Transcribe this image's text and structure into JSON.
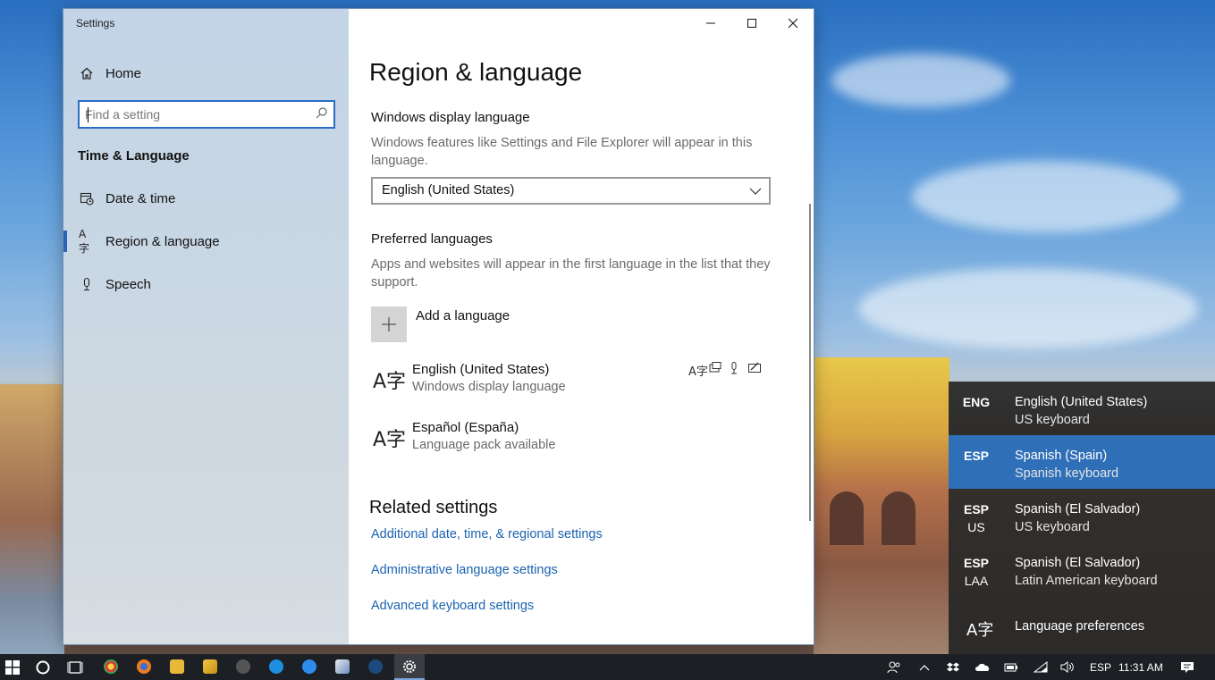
{
  "window": {
    "title": "Settings",
    "minimize_glyph": "—",
    "maximize_glyph": "☐",
    "close_glyph": "✕"
  },
  "sidebar": {
    "home_label": "Home",
    "search_placeholder": "Find a setting",
    "group_title": "Time & Language",
    "items": [
      {
        "label": "Date & time",
        "icon": "calendar-clock-icon"
      },
      {
        "label": "Region & language",
        "icon": "language-icon",
        "active": true
      },
      {
        "label": "Speech",
        "icon": "microphone-icon"
      }
    ]
  },
  "main": {
    "title": "Region & language",
    "display_language": {
      "heading": "Windows display language",
      "description": "Windows features like Settings and File Explorer will appear in this language.",
      "selected": "English (United States)"
    },
    "preferred": {
      "heading": "Preferred languages",
      "description": "Apps and websites will appear in the first language in the list that they support.",
      "add_label": "Add a language",
      "languages": [
        {
          "name": "English (United States)",
          "status": "Windows display language"
        },
        {
          "name": "Español (España)",
          "status": "Language pack available"
        }
      ]
    },
    "related": {
      "heading": "Related settings",
      "links": [
        "Additional date, time, & regional settings",
        "Administrative language settings",
        "Advanced keyboard settings"
      ]
    }
  },
  "flyout": {
    "items": [
      {
        "code": "ENG",
        "sub": "",
        "name": "English (United States)",
        "keyboard": "US keyboard",
        "selected": false
      },
      {
        "code": "ESP",
        "sub": "",
        "name": "Spanish (Spain)",
        "keyboard": "Spanish keyboard",
        "selected": true
      },
      {
        "code": "ESP",
        "sub": "US",
        "name": "Spanish (El Salvador)",
        "keyboard": "US keyboard",
        "selected": false
      },
      {
        "code": "ESP",
        "sub": "LAA",
        "name": "Spanish (El Salvador)",
        "keyboard": "Latin American keyboard",
        "selected": false
      }
    ],
    "preferences_label": "Language preferences"
  },
  "taskbar": {
    "input_indicator": "ESP",
    "clock": "11:31 AM"
  },
  "colors": {
    "accent": "#2f6fb8",
    "link": "#1a63b0",
    "taskbar": "#1c1f24"
  }
}
